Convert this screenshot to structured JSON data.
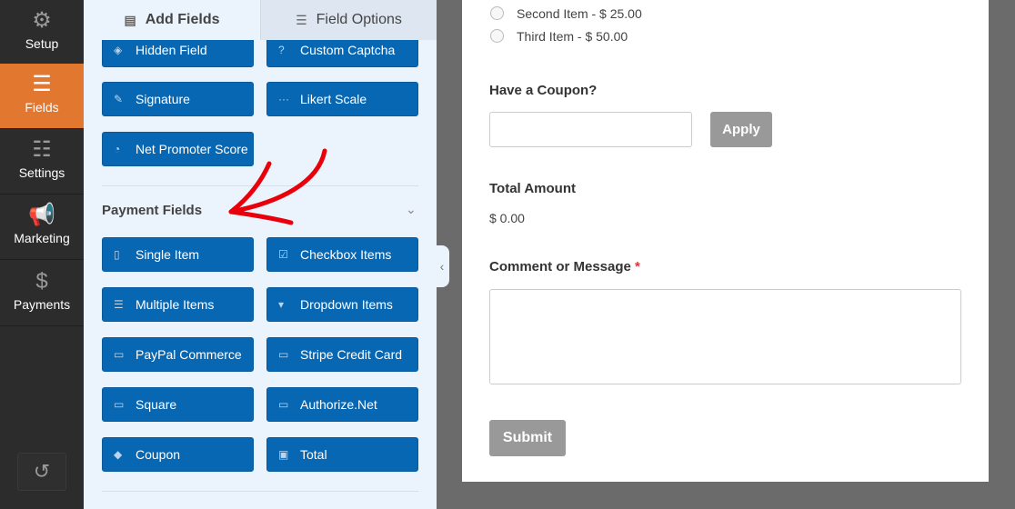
{
  "sidebar": {
    "items": [
      {
        "label": "Setup",
        "icon": "gear-icon"
      },
      {
        "label": "Fields",
        "icon": "list-icon",
        "active": true
      },
      {
        "label": "Settings",
        "icon": "sliders-icon"
      },
      {
        "label": "Marketing",
        "icon": "megaphone-icon"
      },
      {
        "label": "Payments",
        "icon": "dollar-icon"
      }
    ],
    "undo_icon": "history-icon"
  },
  "tabs": [
    {
      "label": "Add Fields",
      "active": true
    },
    {
      "label": "Field Options"
    }
  ],
  "fancy_fields": [
    {
      "label": "Hidden Field",
      "icon": "eye-slash-icon"
    },
    {
      "label": "Custom Captcha",
      "icon": "question-circle-icon"
    },
    {
      "label": "Signature",
      "icon": "pencil-icon"
    },
    {
      "label": "Likert Scale",
      "icon": "ellipsis-icon"
    },
    {
      "label": "Net Promoter Score",
      "icon": "gauge-icon"
    }
  ],
  "payment_section": {
    "title": "Payment Fields",
    "fields": [
      {
        "label": "Single Item",
        "icon": "file-icon"
      },
      {
        "label": "Checkbox Items",
        "icon": "checkbox-icon"
      },
      {
        "label": "Multiple Items",
        "icon": "list-icon"
      },
      {
        "label": "Dropdown Items",
        "icon": "dropdown-icon"
      },
      {
        "label": "PayPal Commerce",
        "icon": "credit-card-icon"
      },
      {
        "label": "Stripe Credit Card",
        "icon": "credit-card-icon"
      },
      {
        "label": "Square",
        "icon": "credit-card-icon"
      },
      {
        "label": "Authorize.Net",
        "icon": "credit-card-icon"
      },
      {
        "label": "Coupon",
        "icon": "ticket-icon"
      },
      {
        "label": "Total",
        "icon": "money-icon"
      }
    ]
  },
  "form": {
    "options": [
      "Second Item - $ 25.00",
      "Third Item - $ 50.00"
    ],
    "coupon_label": "Have a Coupon?",
    "coupon_value": "",
    "apply": "Apply",
    "total_label": "Total Amount",
    "total_value": "$ 0.00",
    "comment_label": "Comment or Message",
    "required_mark": "*",
    "submit": "Submit"
  },
  "colors": {
    "accent": "#e27730",
    "field_button": "#0767b3",
    "annotation_arrow": "#e8000b"
  }
}
